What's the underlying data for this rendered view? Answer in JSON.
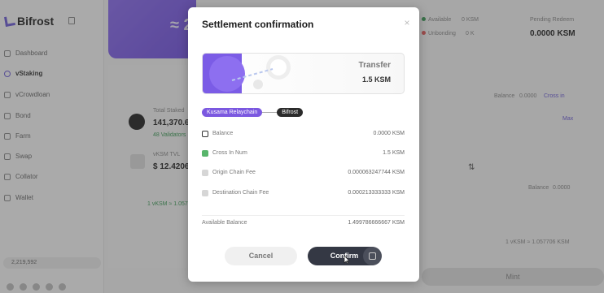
{
  "app": {
    "brand": "Bifrost",
    "nav": [
      {
        "label": "Dashboard"
      },
      {
        "label": "vStaking"
      },
      {
        "label": "vCrowdloan"
      },
      {
        "label": "Bond"
      },
      {
        "label": "Farm"
      },
      {
        "label": "Swap"
      },
      {
        "label": "Collator"
      },
      {
        "label": "Wallet"
      }
    ],
    "block_number": "2,219,592",
    "banner_value": "≈ 2",
    "total_staked_label": "Total Staked",
    "total_staked_value": "141,370.6",
    "validators": "48 Validators",
    "tvl_label": "vKSM TVL",
    "tvl_value": "$ 12.4206",
    "rate_left": "1 vKSM ≈ 1.057",
    "available_label": "Available",
    "available_value": "0 KSM",
    "unbonding_label": "Unbonding",
    "unbonding_value": "0 K",
    "pending_label": "Pending Redeem",
    "pending_value": "0.0000 KSM",
    "balance_top": "Balance",
    "balance_top_value": "0.0000",
    "cross_in": "Cross in",
    "max": "Max",
    "balance_bottom": "Balance",
    "balance_bottom_value": "0.0000",
    "rate_right": "1 vKSM ≈ 1.057706 KSM",
    "mint": "Mint"
  },
  "modal": {
    "title": "Settlement confirmation",
    "close": "×",
    "transfer_label": "Transfer",
    "transfer_amount": "1.5 KSM",
    "chain_from": "Kusama Relaychain",
    "chain_to": "Bifrost",
    "rows": [
      {
        "label": "Balance",
        "value": "0.0000 KSM"
      },
      {
        "label": "Cross In Num",
        "value": "1.5 KSM"
      },
      {
        "label": "Origin Chain Fee",
        "value": "0.000063247744 KSM"
      },
      {
        "label": "Destination Chain Fee",
        "value": "0.000213333333 KSM"
      }
    ],
    "available_balance_label": "Available Balance",
    "available_balance_value": "1.499786666667 KSM",
    "cancel": "Cancel",
    "confirm": "Confirm"
  },
  "colors": {
    "accent": "#7b58e0",
    "confirm": "#343844",
    "green": "#3a9a55"
  },
  "icons": [
    "logo-icon",
    "collapse-icon",
    "close-icon",
    "balance-icon",
    "plus-icon",
    "minus-icon",
    "scan-icon",
    "swap-arrows-icon"
  ]
}
